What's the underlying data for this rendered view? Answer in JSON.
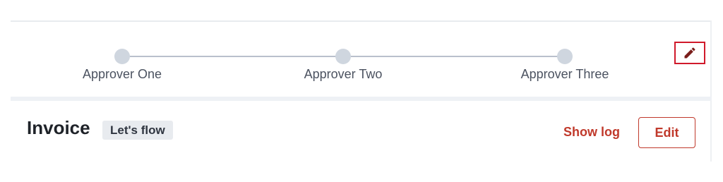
{
  "stepper": {
    "steps": [
      {
        "label": "Approver One"
      },
      {
        "label": "Approver Two"
      },
      {
        "label": "Approver Three"
      }
    ],
    "edit_icon": "pencil-icon",
    "colors": {
      "dot": "#cfd6df",
      "line": "#b9c0cc",
      "highlight": "#d0192b"
    }
  },
  "document": {
    "title": "Invoice",
    "badge": "Let's flow"
  },
  "actions": {
    "show_log": "Show log",
    "edit": "Edit",
    "accent_color": "#c0392b"
  }
}
